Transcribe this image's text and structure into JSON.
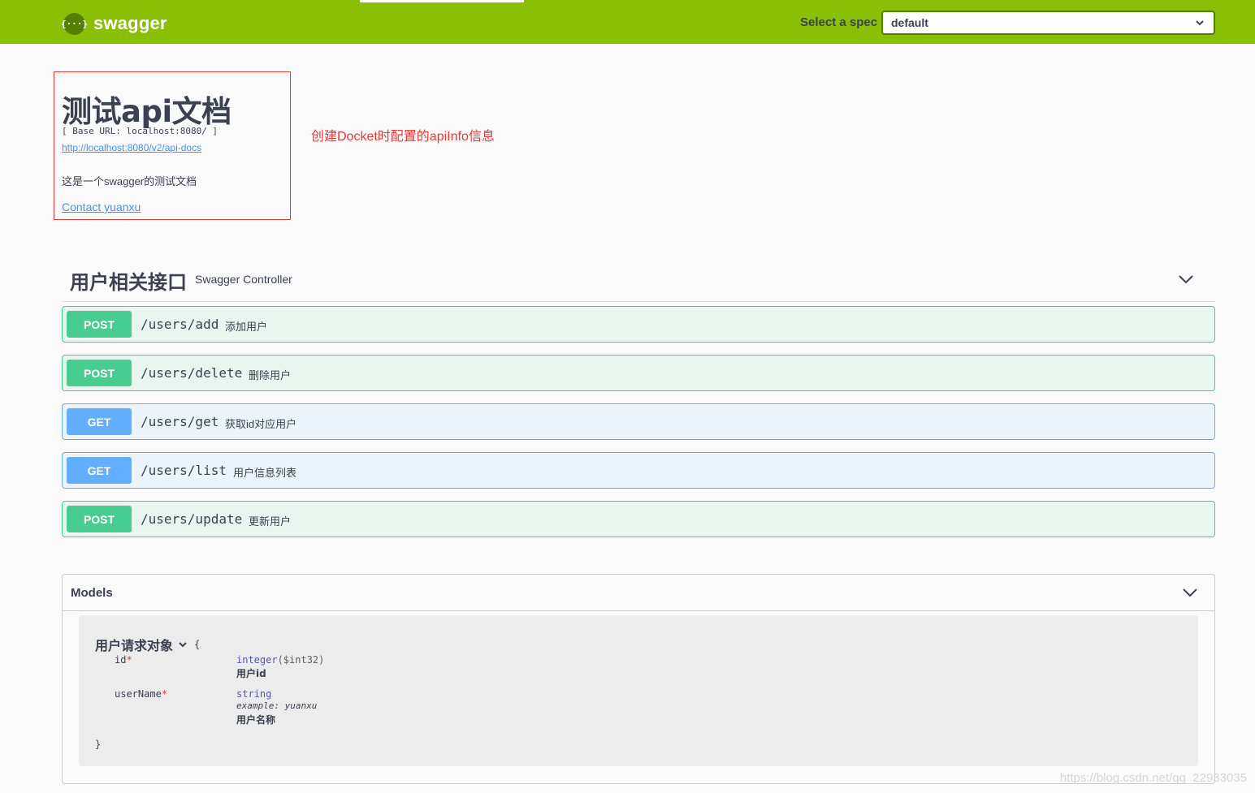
{
  "header": {
    "brand": "swagger",
    "logo_glyph": "{···}",
    "spec_label": "Select a spec",
    "spec_value": "default",
    "bar_color": "#89bf04"
  },
  "info": {
    "title": "测试api文档",
    "base_url": "[ Base URL: localhost:8080/ ]",
    "docs_link": "http://localhost:8080/v2/api-docs",
    "description": "这是一个swagger的测试文档",
    "contact": "Contact yuanxu"
  },
  "annotation": "创建Docket时配置的apiInfo信息",
  "tag": {
    "name": "用户相关接口",
    "description": "Swagger Controller",
    "operations": [
      {
        "method": "POST",
        "path": "/users/add",
        "summary": "添加用户"
      },
      {
        "method": "POST",
        "path": "/users/delete",
        "summary": "删除用户"
      },
      {
        "method": "GET",
        "path": "/users/get",
        "summary": "获取id对应用户"
      },
      {
        "method": "GET",
        "path": "/users/list",
        "summary": "用户信息列表"
      },
      {
        "method": "POST",
        "path": "/users/update",
        "summary": "更新用户"
      }
    ]
  },
  "models": {
    "title": "Models",
    "model": {
      "name": "用户请求对象",
      "open_brace": "{",
      "close_brace": "}",
      "properties": [
        {
          "name": "id",
          "required_mark": "*",
          "type": "integer",
          "format": "($int32)",
          "description": "用户id"
        },
        {
          "name": "userName",
          "required_mark": "*",
          "type": "string",
          "example": "example: yuanxu",
          "description": "用户名称"
        }
      ]
    }
  },
  "watermark": "https://blog.csdn.net/qq_22933035",
  "colors": {
    "post": "#49cc90",
    "get": "#61affe",
    "annotation": "#e53935"
  }
}
